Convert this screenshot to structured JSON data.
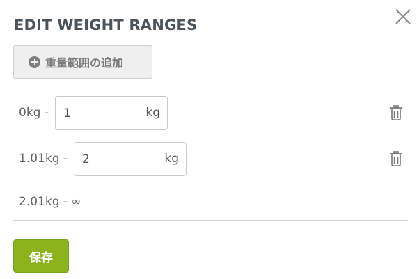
{
  "dialog": {
    "title": "EDIT WEIGHT RANGES",
    "add_button_label": "重量範囲の追加",
    "save_button_label": "保存"
  },
  "ranges": [
    {
      "from_label": "0kg -",
      "value": "1",
      "unit": "kg"
    },
    {
      "from_label": "1.01kg -",
      "value": "2",
      "unit": "kg"
    }
  ],
  "last_range_label": "2.01kg - ∞",
  "icons": {
    "close": "close-icon",
    "add": "plus-circle-icon",
    "delete": "trash-icon"
  },
  "colors": {
    "save_button": "#8cb21c",
    "title": "#4a545a"
  }
}
